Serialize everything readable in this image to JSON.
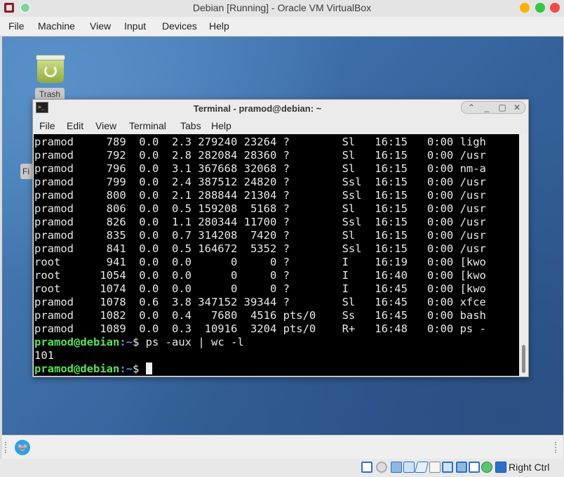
{
  "host": {
    "title": "Debian [Running] - Oracle VM VirtualBox",
    "menu": [
      "File",
      "Machine",
      "View",
      "Input",
      "Devices",
      "Help"
    ],
    "status": {
      "host_key": "Right Ctrl"
    }
  },
  "desktop": {
    "trash_label": "Trash",
    "fs_label": "Fi"
  },
  "terminal": {
    "title": "Terminal - pramod@debian: ~",
    "menu": [
      "File",
      "Edit",
      "View",
      "Terminal",
      "Tabs",
      "Help"
    ],
    "lines": [
      "pramod     789  0.0  2.3 279240 23264 ?        Sl   16:15   0:00 ligh",
      "pramod     792  0.0  2.8 282084 28360 ?        Sl   16:15   0:00 /usr",
      "pramod     796  0.0  3.1 367668 32068 ?        Sl   16:15   0:00 nm-a",
      "pramod     799  0.0  2.4 387512 24820 ?        Ssl  16:15   0:00 /usr",
      "pramod     800  0.0  2.1 288844 21304 ?        Ssl  16:15   0:00 /usr",
      "pramod     806  0.0  0.5 159208  5168 ?        Sl   16:15   0:00 /usr",
      "pramod     826  0.0  1.1 280344 11700 ?        Ssl  16:15   0:00 /usr",
      "pramod     835  0.0  0.7 314208  7420 ?        Sl   16:15   0:00 /usr",
      "pramod     841  0.0  0.5 164672  5352 ?        Ssl  16:15   0:00 /usr",
      "root       941  0.0  0.0      0     0 ?        I    16:19   0:00 [kwo",
      "root      1054  0.0  0.0      0     0 ?        I    16:40   0:00 [kwo",
      "root      1074  0.0  0.0      0     0 ?        I    16:45   0:00 [kwo",
      "pramod    1078  0.6  3.8 347152 39344 ?        Sl   16:45   0:00 xfce",
      "pramod    1082  0.0  0.4   7680  4516 pts/0    Ss   16:45   0:00 bash",
      "pramod    1089  0.0  0.3  10916  3204 pts/0    R+   16:48   0:00 ps -"
    ],
    "prompt_user": "pramod@debian",
    "prompt_path": ":~",
    "prompt_symbol": "$",
    "command": " ps -aux | wc -l",
    "output": "101"
  }
}
